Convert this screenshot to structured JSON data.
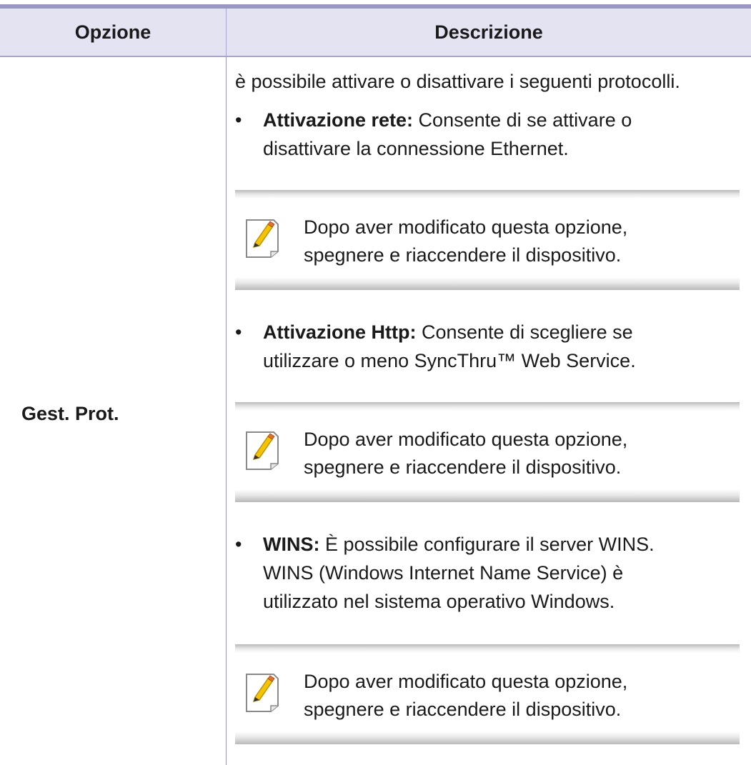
{
  "header": {
    "col_option": "Opzione",
    "col_description": "Descrizione"
  },
  "row": {
    "option": "Gest. Prot.",
    "intro": "è possibile attivare o disattivare i seguenti protocolli.",
    "items": [
      {
        "term": "Attivazione rete:",
        "line1_rest": " Consente di se attivare o",
        "line2": "disattivare la connessione Ethernet.",
        "note": {
          "line1": "Dopo aver modificato questa opzione,",
          "line2": "spegnere e riaccendere il dispositivo."
        }
      },
      {
        "term": "Attivazione Http:",
        "line1_rest": " Consente di scegliere se",
        "line2": "utilizzare o meno SyncThru™ Web Service.",
        "note": {
          "line1": "Dopo aver modificato questa opzione,",
          "line2": "spegnere e riaccendere il dispositivo."
        }
      },
      {
        "term": "WINS:",
        "line1_rest": " È possibile configurare il server WINS.",
        "line2": "WINS (Windows Internet Name Service) è",
        "line3": "utilizzato nel sistema operativo Windows.",
        "note": {
          "line1": "Dopo aver modificato questa opzione,",
          "line2": "spegnere e riaccendere il dispositivo."
        }
      }
    ]
  },
  "bullet_glyph": "•",
  "icons": {
    "note": "note-pencil-icon"
  },
  "colors": {
    "header_bg": "#e4e3f2",
    "rule": "#9a97c6"
  }
}
